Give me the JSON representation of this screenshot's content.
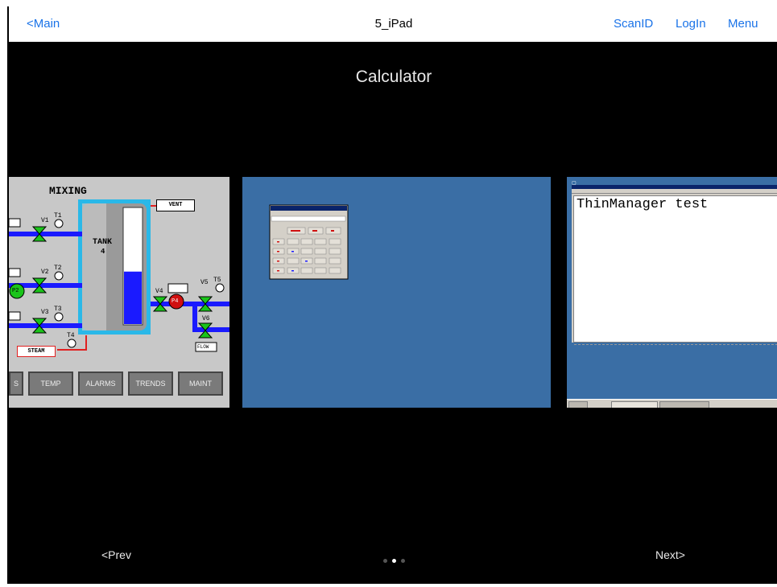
{
  "navbar": {
    "back_label": "<Main",
    "title": "5_iPad",
    "scan_label": "ScanID",
    "login_label": "LogIn",
    "menu_label": "Menu"
  },
  "screen_title": "Calculator",
  "slides": {
    "left": {
      "title": "MIXING",
      "tank_label": "TANK",
      "tank_number": "4",
      "tank_level_percent": 45,
      "vent_label": "VENT",
      "steam_label": "STEAM",
      "flow_label": "FLOW",
      "valve_labels": [
        "V1",
        "V2",
        "V3",
        "V4",
        "V5",
        "V6"
      ],
      "temp_labels": [
        "T1",
        "T2",
        "T3",
        "T4",
        "T5"
      ],
      "pump_labels": [
        "P2",
        "P4"
      ],
      "buttons": [
        "S",
        "TEMP",
        "ALARMS",
        "TRENDS",
        "MAINT"
      ]
    },
    "right": {
      "editor_text": "ThinManager test"
    }
  },
  "pager": {
    "prev_label": "<Prev",
    "next_label": "Next>",
    "page_count": 3,
    "current_page": 2
  },
  "colors": {
    "link": "#1a73e8",
    "desktop_blue": "#3a6ea5",
    "background": "#000000"
  }
}
